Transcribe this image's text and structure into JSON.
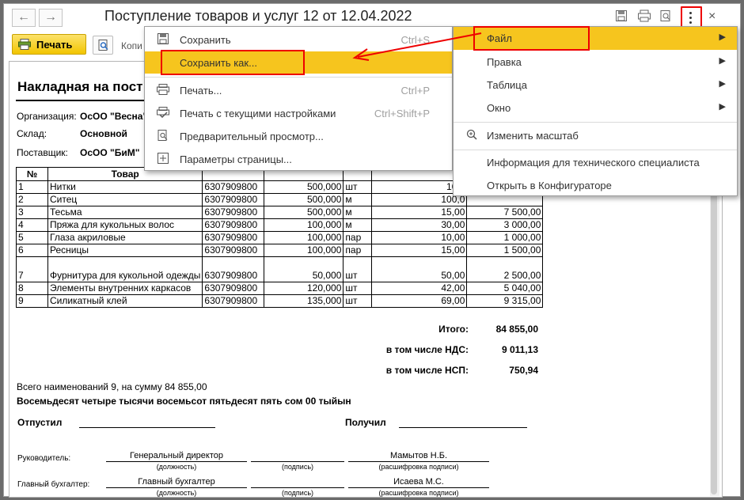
{
  "window": {
    "title": "Поступление товаров и услуг 12 от 12.04.2022"
  },
  "toolbar": {
    "print_label": "Печать",
    "copies_label": "Копи"
  },
  "doc": {
    "title": "Накладная на пост",
    "org_label": "Организация:",
    "org_value": "ОсОО \"Весна\"",
    "warehouse_label": "Склад:",
    "warehouse_value": "Основной",
    "supplier_label": "Поставщик:",
    "supplier_value": "ОсОО \"БиМ\"",
    "columns": [
      "№",
      "Товар"
    ],
    "rows": [
      {
        "n": "1",
        "name": "Нитки",
        "code": "6307909800",
        "qty": "500,000",
        "unit": "шт",
        "price": "10,0",
        "sum": ""
      },
      {
        "n": "2",
        "name": "Ситец",
        "code": "6307909800",
        "qty": "500,000",
        "unit": "м",
        "price": "100,0",
        "sum": ""
      },
      {
        "n": "3",
        "name": "Тесьма",
        "code": "6307909800",
        "qty": "500,000",
        "unit": "м",
        "price": "15,00",
        "sum": "7 500,00"
      },
      {
        "n": "4",
        "name": "Пряжа для кукольных волос",
        "code": "6307909800",
        "qty": "100,000",
        "unit": "м",
        "price": "30,00",
        "sum": "3 000,00"
      },
      {
        "n": "5",
        "name": "Глаза акриловые",
        "code": "6307909800",
        "qty": "100,000",
        "unit": "пар",
        "price": "10,00",
        "sum": "1 000,00"
      },
      {
        "n": "6",
        "name": "Ресницы",
        "code": "6307909800",
        "qty": "100,000",
        "unit": "пар",
        "price": "15,00",
        "sum": "1 500,00"
      },
      {
        "n": "7",
        "name": "Фурнитура для кукольной одежды",
        "code": "6307909800",
        "qty": "50,000",
        "unit": "шт",
        "price": "50,00",
        "sum": "2 500,00"
      },
      {
        "n": "8",
        "name": "Элементы внутренних каркасов",
        "code": "6307909800",
        "qty": "120,000",
        "unit": "шт",
        "price": "42,00",
        "sum": "5 040,00"
      },
      {
        "n": "9",
        "name": "Силикатный клей",
        "code": "6307909800",
        "qty": "135,000",
        "unit": "шт",
        "price": "69,00",
        "sum": "9 315,00"
      }
    ],
    "total_label": "Итого:",
    "total_value": "84 855,00",
    "vat_label": "в том числе НДС:",
    "vat_value": "9 011,13",
    "nsp_label": "в том числе НСП:",
    "nsp_value": "750,94",
    "summary_line": "Всего наименований 9, на сумму 84 855,00",
    "summary_words": "Восемьдесят четыре тысячи восемьсот пятьдесят пять сом 00 тыйын",
    "released_label": "Отпустил",
    "received_label": "Получил",
    "head_label": "Руководитель:",
    "head_position": "Генеральный директор",
    "head_name": "Мамытов Н.Б.",
    "accountant_label": "Главный бухгалтер:",
    "accountant_position": "Главный бухгалтер",
    "accountant_name": "Исаева М.С.",
    "caption_position": "(должность)",
    "caption_signature": "(подпись)",
    "caption_decode": "(расшифровка подписи)"
  },
  "menu_left": {
    "items": [
      {
        "label": "Сохранить",
        "shortcut": "Ctrl+S",
        "icon": "floppy-disk-icon"
      },
      {
        "label": "Сохранить как...",
        "shortcut": "",
        "icon": ""
      },
      {
        "label": "Печать...",
        "shortcut": "Ctrl+P",
        "icon": "printer-icon"
      },
      {
        "label": "Печать с текущими настройками",
        "shortcut": "Ctrl+Shift+P",
        "icon": "printer-check-icon"
      },
      {
        "label": "Предварительный просмотр...",
        "shortcut": "",
        "icon": "print-preview-icon"
      },
      {
        "label": "Параметры страницы...",
        "shortcut": "",
        "icon": "page-setup-icon"
      }
    ]
  },
  "menu_right": {
    "items": [
      {
        "label": "Файл",
        "has_submenu": true
      },
      {
        "label": "Правка",
        "has_submenu": true
      },
      {
        "label": "Таблица",
        "has_submenu": true
      },
      {
        "label": "Окно",
        "has_submenu": true
      },
      {
        "label": "Изменить масштаб",
        "has_submenu": false,
        "icon": "zoom-icon"
      },
      {
        "label": "Информация для технического специалиста",
        "has_submenu": false
      },
      {
        "label": "Открыть в Конфигураторе",
        "has_submenu": false
      }
    ]
  },
  "colors": {
    "highlight": "#f6c51e",
    "annotation": "#e00000",
    "print_button": "#f2c500"
  }
}
